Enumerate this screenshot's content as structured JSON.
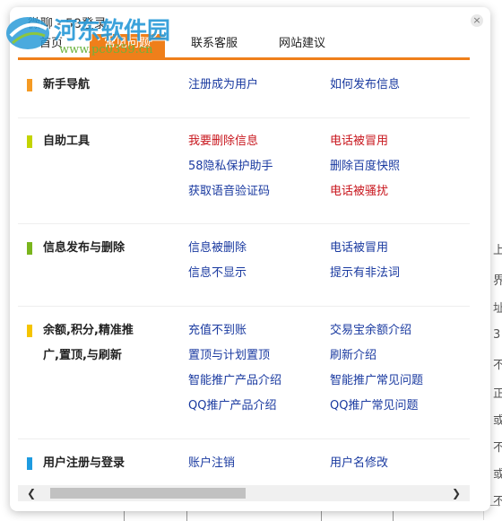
{
  "window": {
    "title": "微聊 - 58登录"
  },
  "watermark": {
    "text": "河东软件园",
    "url": "www.pc0359.cn"
  },
  "tabs": [
    {
      "label": "首页"
    },
    {
      "label": "常见问题"
    },
    {
      "label": "联系客服"
    },
    {
      "label": "网站建议"
    }
  ],
  "sections": [
    {
      "title": "新手导航",
      "color": "#f59a23",
      "links": [
        {
          "label": "注册成为用户"
        },
        {
          "label": "如何发布信息"
        }
      ]
    },
    {
      "title": "自助工具",
      "color": "#c3d400",
      "links": [
        {
          "label": "我要删除信息"
        },
        {
          "label": "电话被冒用"
        },
        {
          "label": "58隐私保护助手"
        },
        {
          "label": "删除百度快照"
        },
        {
          "label": "获取语音验证码"
        },
        {
          "label": "电话被骚扰"
        }
      ]
    },
    {
      "title": "信息发布与删除",
      "color": "#7ab51d",
      "links": [
        {
          "label": "信息被删除"
        },
        {
          "label": "电话被冒用"
        },
        {
          "label": "信息不显示"
        },
        {
          "label": "提示有非法词"
        }
      ]
    },
    {
      "title_line1": "余额,积分,精准推",
      "title_line2": "广,置顶,与刷新",
      "color": "#f5c400",
      "links": [
        {
          "label": "充值不到账"
        },
        {
          "label": "交易宝余额介绍"
        },
        {
          "label": "置顶与计划置顶"
        },
        {
          "label": "刷新介绍"
        },
        {
          "label": "智能推广产品介绍"
        },
        {
          "label": "智能推广常见问题"
        },
        {
          "label": "QQ推广产品介绍"
        },
        {
          "label": "QQ推广常见问题"
        }
      ]
    },
    {
      "title": "用户注册与登录",
      "color": "#1e9be0",
      "links": [
        {
          "label": "账户注销"
        },
        {
          "label": "用户名修改"
        }
      ]
    }
  ],
  "background_chars": [
    "上",
    "界",
    "址",
    "3",
    "不",
    "正",
    "或",
    "不",
    "或",
    "不"
  ]
}
